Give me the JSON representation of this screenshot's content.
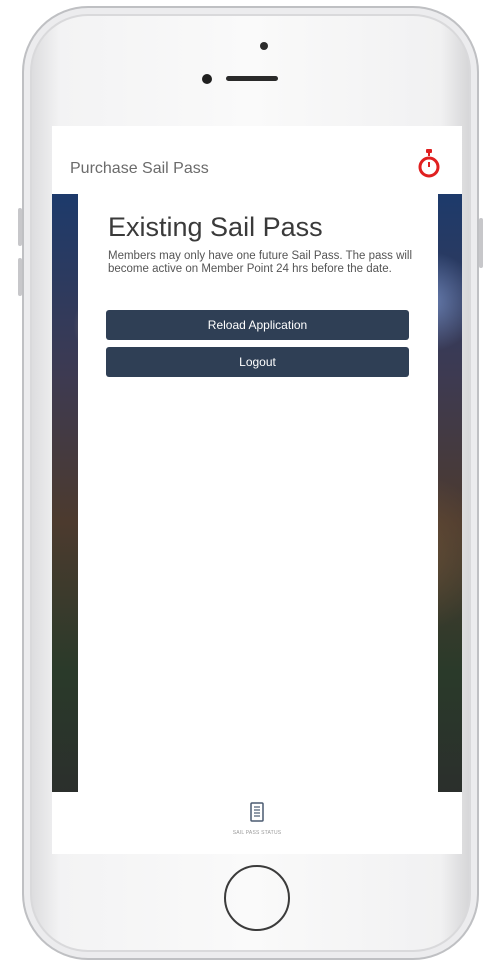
{
  "header": {
    "title": "Purchase Sail Pass"
  },
  "card": {
    "title": "Existing Sail Pass",
    "message": "Members may only have one future Sail Pass. The pass will become active on Member Point 24 hrs before the date."
  },
  "buttons": {
    "reload": "Reload Application",
    "logout": "Logout"
  },
  "bottom_nav": {
    "label": "SAIL PASS STATUS"
  },
  "colors": {
    "button_bg": "#2f3f55",
    "timer_accent": "#e02020"
  },
  "icons": {
    "header_right": "stopwatch-icon",
    "bottom_nav": "document-icon"
  }
}
